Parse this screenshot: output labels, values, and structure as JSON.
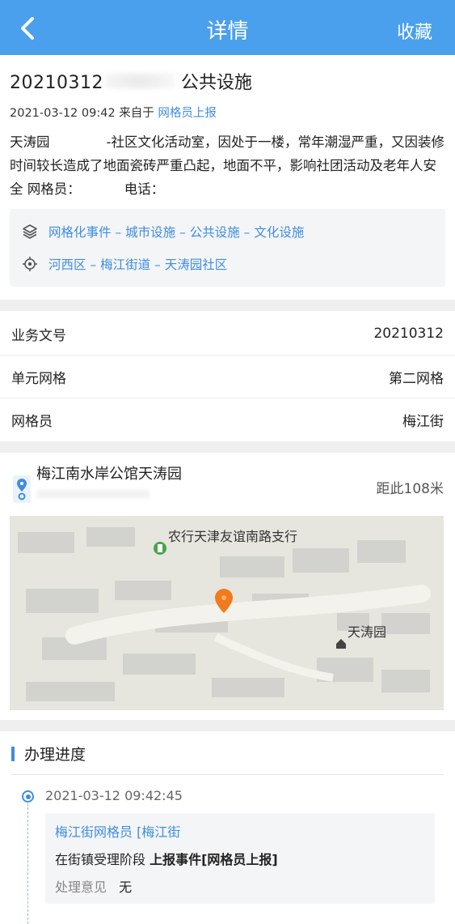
{
  "header": {
    "title": "详情",
    "favorite_label": "收藏",
    "back_icon": "chevron-left-icon"
  },
  "case": {
    "number": "20210312",
    "category": "公共设施",
    "time": "2021-03-12 09:42",
    "source_prefix": "来自于",
    "source": "网格员上报",
    "description_part1": "天涛园",
    "description_part2": "-社区文化活动室，因处于一楼，常年潮湿严重，又因装修时间较长造成了地面瓷砖严重凸起，地面不平，影响社团活动及老年人安全 网格员：",
    "description_part3": "电话：",
    "classification": "网格化事件 – 城市设施 – 公共设施 – 文化设施",
    "area": "河西区 – 梅江街道 – 天涛园社区"
  },
  "fields": [
    {
      "label": "业务文号",
      "value": "20210312"
    },
    {
      "label": "单元网格",
      "value": "第二网格"
    },
    {
      "label": "网格员",
      "value": "梅江街"
    }
  ],
  "location": {
    "name": "梅江南水岸公馆天涛园",
    "distance": "距此108米",
    "map_labels": {
      "bank": "农行天津友谊南路支行",
      "community": "天涛园"
    }
  },
  "progress": {
    "title": "办理进度",
    "entries": [
      {
        "time": "2021-03-12 09:42:45",
        "who": "梅江街网格员 [梅江街",
        "stage_prefix": "在街镇受理阶段",
        "stage_action": "上报事件[网格员上报]",
        "opinion_label": "处理意见",
        "opinion_value": "无"
      }
    ]
  },
  "colors": {
    "accent": "#4aa0ec",
    "link": "#3f8de0",
    "marker": "#f07a1e"
  }
}
